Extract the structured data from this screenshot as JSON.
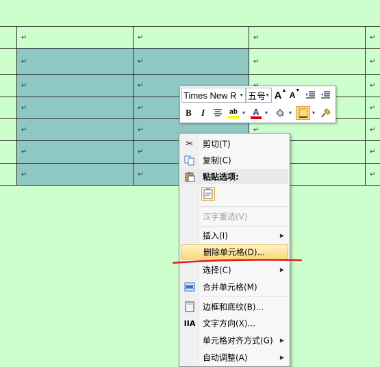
{
  "table": {
    "cell_mark": "↵",
    "selected_region": "rows 2-7, columns 1-2"
  },
  "mini_toolbar": {
    "font_name": "Times New R",
    "font_size": "五号",
    "grow_font": "A",
    "shrink_font": "A",
    "bold": "B",
    "italic": "I",
    "font_color_label": "A",
    "highlight_label": "ab",
    "colors": {
      "highlight": "#ffff00",
      "font_color": "#e00000",
      "active_button": "#ffd973"
    }
  },
  "context_menu": {
    "cut": "剪切(T)",
    "copy": "复制(C)",
    "paste_options_header": "粘贴选项:",
    "reconvert": "汉字重选(V)",
    "insert": "插入(I)",
    "delete_cells": "删除单元格(D)...",
    "select": "选择(C)",
    "merge_cells": "合并单元格(M)",
    "borders_shading": "边框和底纹(B)...",
    "text_direction": "文字方向(X)...",
    "cell_alignment": "单元格对齐方式(G)",
    "autofit": "自动调整(A)",
    "highlight_color": "#fcd97b",
    "underline_annotation_color": "#e02020"
  }
}
